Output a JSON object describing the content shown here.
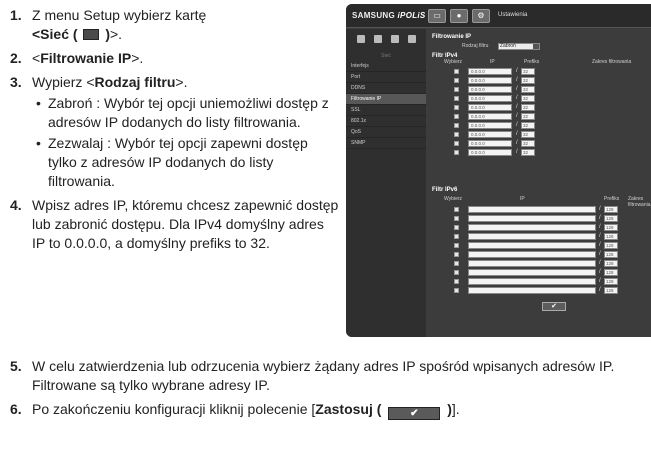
{
  "steps": {
    "s1": {
      "num": "1.",
      "pre": "Z menu Setup wybierz kartę",
      "bold_pre": "<Sieć (",
      "bold_post": ")",
      "post": ">."
    },
    "s2": {
      "num": "2.",
      "pre": "<",
      "bold": "Filtrowanie IP",
      "post": ">."
    },
    "s3": {
      "num": "3.",
      "pre": "Wypierz <",
      "bold": "Rodzaj filtru",
      "post": ">.",
      "bullets": [
        "Zabroń : Wybór tej opcji uniemożliwi dostęp z adresów IP dodanych do listy filtrowania.",
        "Zezwalaj : Wybór tej opcji zapewni dostęp tylko z adresów IP dodanych do listy filtrowania."
      ]
    },
    "s4": {
      "num": "4.",
      "text": "Wpisz adres IP, któremu chcesz zapewnić dostęp lub zabronić dostępu. Dla IPv4 domyślny adres IP to 0.0.0.0, a domyślny prefiks to 32."
    },
    "s5": {
      "num": "5.",
      "line1": "W celu zatwierdzenia lub odrzucenia wybierz żądany adres IP spośród wpisanych adresów IP.",
      "line2": "Filtrowane są tylko wybrane adresy IP."
    },
    "s6": {
      "num": "6.",
      "pre": "Po zakończeniu konfiguracji kliknij polecenie [",
      "bold_pre": "Zastosuj (",
      "bold_post": ")",
      "post": "]."
    }
  },
  "ui": {
    "logo_brand": "SAMSUNG",
    "logo_product": "iPOLiS",
    "top_title": "Ustawienia",
    "sidebar_head": "Sieć",
    "sidebar_items": [
      "Interfejs",
      "Port",
      "DDNS",
      "Filtrowanie IP",
      "SSL",
      "802.1x",
      "QoS",
      "SNMP"
    ],
    "active_index": 3,
    "filter_title": "Filtrowanie IP",
    "filter_type_label": "Rodzaj filtru",
    "filter_type_value": "Zabroń",
    "ipv4_title": "Filtr IPv4",
    "ipv6_title": "Filtr IPv6",
    "col_use": "Wybierz",
    "col_ip": "IP",
    "col_prefix": "Prefiks",
    "col_address": "Zakres filtrowania",
    "ipv4_default": "0.0.0.0",
    "prefix_v4": "32",
    "prefix_v6": "128",
    "ok_symbol": "✔"
  }
}
